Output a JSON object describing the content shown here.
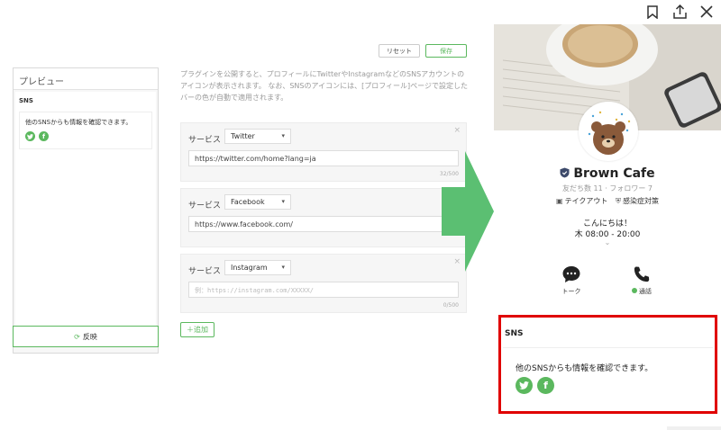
{
  "toolbar": {
    "bookmark_icon": "bookmark-icon",
    "share_icon": "share-icon",
    "close_icon": "close-icon"
  },
  "preview": {
    "title": "プレビュー",
    "sns_label": "SNS",
    "card_text": "他のSNSからも情報を確認できます。",
    "reflect_label": "反映"
  },
  "editor": {
    "reset_label": "リセット",
    "save_label": "保存",
    "description": "プラグインを公開すると、プロフィールにTwitterやInstagramなどのSNSアカウントのアイコンが表示されます。 なお、SNSのアイコンには、[プロフィール]ページで設定したバーの色が自動で適用されます。",
    "service_label": "サービス",
    "services": [
      {
        "name": "Twitter",
        "value": "https://twitter.com/home?lang=ja",
        "count": "32/500"
      },
      {
        "name": "Facebook",
        "value": "https://www.facebook.com/",
        "count": ""
      },
      {
        "name": "Instagram",
        "placeholder": "例：https://instagram.com/XXXXX/",
        "count": "0/500"
      }
    ],
    "add_label": "追加"
  },
  "profile": {
    "name": "Brown Cafe",
    "stats": "友だち数 11 · フォロワー 7",
    "tag_takeout": "テイクアウト",
    "tag_safety": "感染症対策",
    "greeting": "こんにちは！",
    "hours": "木 08:00 - 20:00",
    "action_talk": "トーク",
    "action_call": "通話"
  },
  "sns_box": {
    "title": "SNS",
    "text": "他のSNSからも情報を確認できます。"
  },
  "colors": {
    "accent": "#5bb85e",
    "highlight": "#e00000"
  }
}
